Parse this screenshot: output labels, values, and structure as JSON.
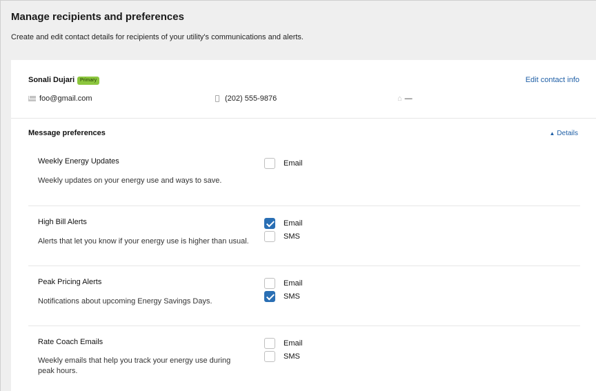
{
  "page": {
    "title": "Manage recipients and preferences",
    "subtitle": "Create and edit contact details for recipients of your utility's communications and alerts."
  },
  "contact": {
    "name": "Sonali Dujari",
    "badge": "Primary",
    "edit_label": "Edit contact info",
    "email": "foo@gmail.com",
    "phone": "(202) 555-9876",
    "home": "—"
  },
  "preferences": {
    "title": "Message preferences",
    "details_label": "Details",
    "items": [
      {
        "name": "Weekly Energy Updates",
        "description": "Weekly updates on your energy use and ways to save.",
        "options": [
          {
            "label": "Email",
            "checked": false
          }
        ]
      },
      {
        "name": "High Bill Alerts",
        "description": "Alerts that let you know if your energy use is higher than usual.",
        "options": [
          {
            "label": "Email",
            "checked": true
          },
          {
            "label": "SMS",
            "checked": false
          }
        ]
      },
      {
        "name": "Peak Pricing Alerts",
        "description": "Notifications about upcoming Energy Savings Days.",
        "options": [
          {
            "label": "Email",
            "checked": false
          },
          {
            "label": "SMS",
            "checked": true
          }
        ]
      },
      {
        "name": "Rate Coach Emails",
        "description": "Weekly emails that help you track your energy use during peak hours.",
        "options": [
          {
            "label": "Email",
            "checked": false
          },
          {
            "label": "SMS",
            "checked": false
          }
        ]
      }
    ]
  },
  "colors": {
    "accent": "#1f5fa6",
    "badge": "#8cc63e",
    "checkbox_checked": "#2a6fb4"
  }
}
